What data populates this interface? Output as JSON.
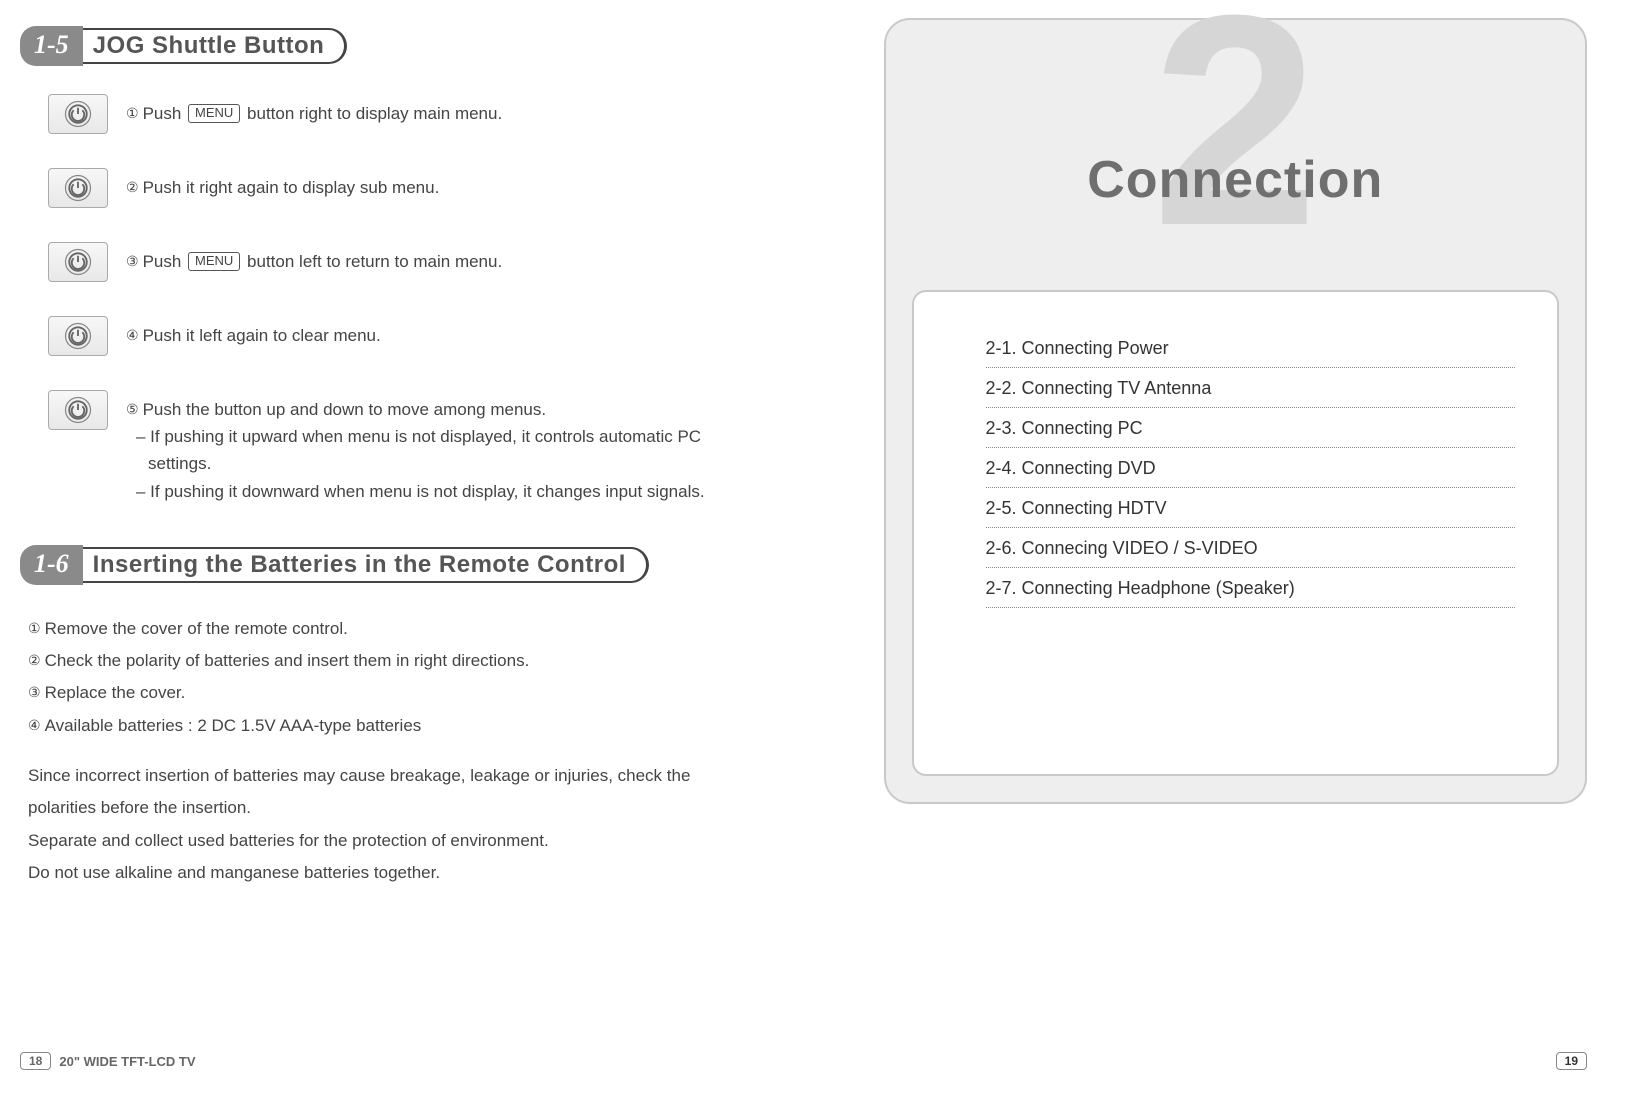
{
  "left": {
    "section15": {
      "num": "1-5",
      "title": "JOG Shuttle Button",
      "steps": [
        {
          "n": "①",
          "pre": "Push ",
          "menu": "MENU",
          "post": " button right to display main menu."
        },
        {
          "n": "②",
          "pre": "Push it right again to display sub menu.",
          "menu": null,
          "post": ""
        },
        {
          "n": "③",
          "pre": "Push ",
          "menu": "MENU",
          "post": " button left to return to main menu."
        },
        {
          "n": "④",
          "pre": "Push it left again to clear menu.",
          "menu": null,
          "post": ""
        },
        {
          "n": "⑤",
          "pre": "Push the button up and down to move among menus.",
          "menu": null,
          "post": "",
          "subs": [
            "If pushing it upward when menu is not displayed, it controls automatic PC settings.",
            "If pushing it downward when menu is not display, it changes input signals."
          ]
        }
      ]
    },
    "section16": {
      "num": "1-6",
      "title": "Inserting the Batteries in the Remote Control",
      "lines": [
        {
          "n": "①",
          "text": "Remove the cover of the remote control."
        },
        {
          "n": "②",
          "text": "Check the polarity of batteries and insert them in right directions."
        },
        {
          "n": "③",
          "text": "Replace the cover."
        },
        {
          "n": "④",
          "text": "Available batteries : 2 DC 1.5V AAA-type batteries"
        }
      ],
      "notes": [
        "Since incorrect insertion of batteries may cause breakage, leakage or injuries, check the polarities before the insertion.",
        "Separate and collect used batteries for the protection of environment.",
        "Do not use alkaline and manganese batteries together."
      ]
    },
    "footer": {
      "page": "18",
      "product": "20\" WIDE TFT-LCD TV"
    }
  },
  "right": {
    "chapter_number": "2",
    "chapter_title": "Connection",
    "toc": [
      "2-1. Connecting Power",
      "2-2. Connecting TV Antenna",
      "2-3. Connecting PC",
      "2-4. Connecting DVD",
      "2-5. Connecting HDTV",
      "2-6. Connecing VIDEO / S-VIDEO",
      "2-7. Connecting Headphone (Speaker)"
    ],
    "footer": {
      "page": "19"
    }
  }
}
